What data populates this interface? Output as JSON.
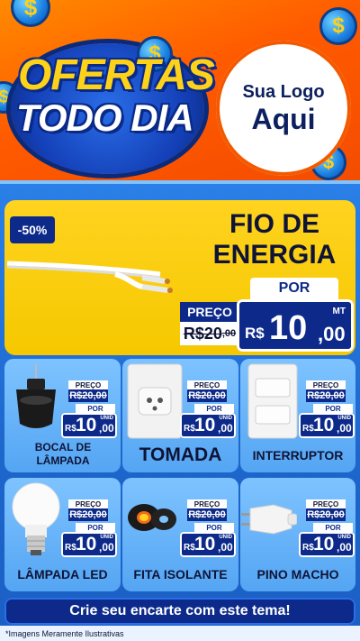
{
  "header": {
    "title_line1": "OFERTAS",
    "title_line2": "TODO DIA",
    "logo_line1": "Sua Logo",
    "logo_line2": "Aqui",
    "coin_symbol": "$"
  },
  "featured": {
    "discount": "-50%",
    "title_line1": "FIO DE",
    "title_line2": "ENERGIA",
    "por_label": "POR",
    "preco_label": "PREÇO",
    "old_price_int": "R$20",
    "old_price_dec": ",00",
    "currency": "R$",
    "price_int": "10",
    "price_dec": ",00",
    "unit": "MT",
    "cable_icon": "cable-icon"
  },
  "products": [
    {
      "name": "BOCAL DE LÂMPADA",
      "icon": "lamp-socket-icon",
      "preco_label": "PREÇO",
      "old_price": "R$20,00",
      "por_label": "POR",
      "currency": "R$",
      "price_int": "10",
      "price_dec": ",00",
      "unit": "UNID"
    },
    {
      "name": "TOMADA",
      "icon": "outlet-icon",
      "preco_label": "PREÇO",
      "old_price": "R$20,00",
      "por_label": "POR",
      "currency": "R$",
      "price_int": "10",
      "price_dec": ",00",
      "unit": "UNID"
    },
    {
      "name": "INTERRUPTOR",
      "icon": "switch-icon",
      "preco_label": "PREÇO",
      "old_price": "R$20,00",
      "por_label": "POR",
      "currency": "R$",
      "price_int": "10",
      "price_dec": ",00",
      "unit": "UNID"
    },
    {
      "name": "LÂMPADA LED",
      "icon": "led-bulb-icon",
      "preco_label": "PREÇO",
      "old_price": "R$20,00",
      "por_label": "POR",
      "currency": "R$",
      "price_int": "10",
      "price_dec": ",00",
      "unit": "UNID"
    },
    {
      "name": "FITA ISOLANTE",
      "icon": "tape-icon",
      "preco_label": "PREÇO",
      "old_price": "R$20,00",
      "por_label": "POR",
      "currency": "R$",
      "price_int": "10",
      "price_dec": ",00",
      "unit": "UNID"
    },
    {
      "name": "PINO MACHO",
      "icon": "plug-icon",
      "preco_label": "PREÇO",
      "old_price": "R$20,00",
      "por_label": "POR",
      "currency": "R$",
      "price_int": "10",
      "price_dec": ",00",
      "unit": "UNID"
    }
  ],
  "cta_label": "Crie seu encarte com este tema!",
  "footer_note": "*Imagens Meramente Ilustrativas",
  "colors": {
    "orange": "#ff6a00",
    "navy": "#0d2a8a",
    "yellow": "#ffd31f",
    "light_blue": "#7ec3ff"
  }
}
